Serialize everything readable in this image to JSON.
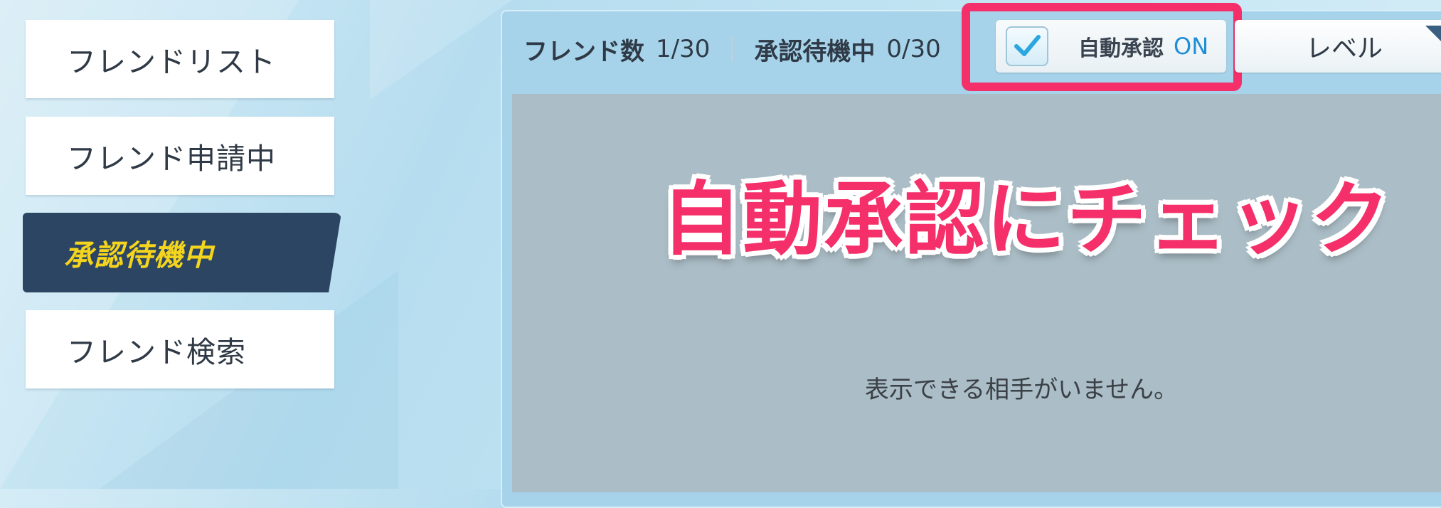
{
  "menu": {
    "items": [
      {
        "label": "フレンドリスト"
      },
      {
        "label": "フレンド申請中"
      },
      {
        "label": "承認待機中"
      },
      {
        "label": "フレンド検索"
      }
    ]
  },
  "header": {
    "friends_label": "フレンド数",
    "friends_value": "1/30",
    "pending_label": "承認待機中",
    "pending_value": "0/30",
    "auto_approve_label": "自動承認",
    "auto_approve_state": "ON",
    "auto_approve_checked": true,
    "sort_label": "レベル"
  },
  "content": {
    "empty_message": "表示できる相手がいません。"
  },
  "annotation": {
    "text": "自動承認にチェック",
    "color": "#f42f69"
  },
  "colors": {
    "active_menu_bg": "#2c4562",
    "active_menu_text": "#f4d41c",
    "accent_on": "#1f8ed8",
    "highlight": "#f42f69"
  }
}
